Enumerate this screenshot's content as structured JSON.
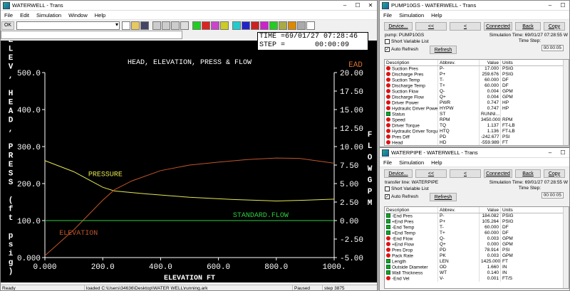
{
  "main": {
    "title": "WATERWELL - Trans",
    "menu": [
      "File",
      "Edit",
      "Simulation",
      "Window",
      "Help"
    ],
    "ok_label": "OK",
    "time_label": "TIME =",
    "time_value": "69/01/27 07:28:46",
    "step_label": "STEP =",
    "step_value": "00:00:09",
    "status": {
      "left": "Ready",
      "file": "loaded C:\\Users\\34636\\Desktop\\WATER WELL\\running.ark",
      "state": "Paused",
      "step": "step 3875"
    }
  },
  "chart_data": {
    "type": "line",
    "title": "HEAD, ELEVATION, PRESS & FLOW",
    "xlabel": "ELEVATION FT",
    "ylabel_left": "ELEV, HEAD, PRESS (ft psig)",
    "ylabel_right": "FLOW GPM",
    "ylabel_right_top": "EAD",
    "xlim": [
      0,
      1000
    ],
    "ylim_left": [
      0,
      500
    ],
    "ylim_right": [
      -5,
      20
    ],
    "x_ticks": [
      "0.000",
      "200.0",
      "400.0",
      "600.0",
      "800.0",
      "1000."
    ],
    "y_ticks_left": [
      "0.000",
      "100.0",
      "200.0",
      "300.0",
      "400.0",
      "500.0"
    ],
    "y_ticks_right": [
      "-5.00",
      "-2.50",
      "0.00",
      "2.50",
      "5.00",
      "7.50",
      "10.00",
      "12.50",
      "15.00",
      "17.50",
      "20.00"
    ],
    "series": [
      {
        "name": "PRESSURE",
        "color": "#e6e650",
        "axis": "left",
        "x": [
          0,
          100,
          200,
          240,
          350,
          500,
          650,
          800,
          900,
          1000
        ],
        "y": [
          262,
          232,
          190,
          180,
          172,
          163,
          157,
          153,
          155,
          158
        ]
      },
      {
        "name": "ELEVATION",
        "color": "#c0552a",
        "axis": "left",
        "x": [
          0,
          100,
          200,
          240,
          300,
          400,
          500,
          600,
          700,
          800,
          880,
          1000
        ],
        "y": [
          5,
          75,
          155,
          183,
          207,
          235,
          250,
          258,
          265,
          269,
          268,
          255
        ]
      },
      {
        "name": "STANDARD.FLOW",
        "color": "#2ecc40",
        "axis": "right",
        "x": [
          0,
          1000
        ],
        "y": [
          0,
          0
        ]
      }
    ],
    "labels": [
      {
        "text": "PRESSURE",
        "color": "#e6e650"
      },
      {
        "text": "ELEVATION",
        "color": "#c0552a"
      },
      {
        "text": "STANDARD.FLOW",
        "color": "#2ecc40"
      }
    ]
  },
  "pump": {
    "title": "PUMP10GS - WATERWELL - Trans",
    "menu": [
      "File",
      "Simulation",
      "Help"
    ],
    "buttons": [
      "Device...",
      "<<",
      "<",
      "Connected",
      "Back",
      "Copy"
    ],
    "name": "pump: PUMP10GS",
    "sim_time_label": "Simulation Time:",
    "sim_time": "69/01/27 07:28:55 W",
    "time_step_label": "Time Step:",
    "time_step": "00:00:05",
    "short_var": "Short Variable List",
    "auto_refresh": "Auto Refresh",
    "refresh": "Refresh",
    "headers": [
      "Description",
      "Abbrev.",
      "Value",
      "Units"
    ],
    "rows": [
      {
        "d": "Suction Pres",
        "a": "P-",
        "v": "17.000",
        "u": "PSIG",
        "i": "dot"
      },
      {
        "d": "Discharge Pres",
        "a": "P+",
        "v": "259.676",
        "u": "PSIG",
        "i": "dot"
      },
      {
        "d": "Suction Temp",
        "a": "T-",
        "v": "60.000",
        "u": "DF",
        "i": "dot"
      },
      {
        "d": "Discharge Temp",
        "a": "T+",
        "v": "60.000",
        "u": "DF",
        "i": "dot"
      },
      {
        "d": "Suction Flow",
        "a": "Q-",
        "v": "0.004",
        "u": "GPM",
        "i": "dot"
      },
      {
        "d": "Discharge Flow",
        "a": "Q+",
        "v": "0.004",
        "u": "GPM",
        "i": "dot"
      },
      {
        "d": "Driver Power",
        "a": "PWR",
        "v": "0.747",
        "u": "HP",
        "i": "dot"
      },
      {
        "d": "Hydraulic Driver Power",
        "a": "HYPW",
        "v": "0.747",
        "u": "HP",
        "i": "dot"
      },
      {
        "d": "Status",
        "a": "ST",
        "v": "RUNNI...",
        "u": "",
        "i": "sq"
      },
      {
        "d": "Speed",
        "a": "RPM",
        "v": "3450.000",
        "u": "RPM",
        "i": "dot"
      },
      {
        "d": "Driver Torque",
        "a": "TQ",
        "v": "1.137",
        "u": "FT-LB",
        "i": "dot"
      },
      {
        "d": "Hydraulic Driver Torque",
        "a": "HTQ",
        "v": "1.136",
        "u": "FT-LB",
        "i": "dot"
      },
      {
        "d": "Pres Diff",
        "a": "PD",
        "v": "-242.677",
        "u": "PSI",
        "i": "dot"
      },
      {
        "d": "Head",
        "a": "HD",
        "v": "-559.989",
        "u": "FT",
        "i": "dot"
      }
    ]
  },
  "pipe": {
    "title": "WATERPIPE - WATERWELL - Trans",
    "menu": [
      "File",
      "Simulation",
      "Help"
    ],
    "buttons": [
      "Device...",
      "<<",
      "<",
      "Connected",
      "Back",
      "Copy"
    ],
    "name": "transfer line: WATERPIPE",
    "sim_time_label": "Simulation Time:",
    "sim_time": "69/01/27 07:28:55 W",
    "time_step_label": "Time Step:",
    "time_step": "00:00:05",
    "short_var": "Short Variable List",
    "auto_refresh": "Auto Refresh",
    "refresh": "Refresh",
    "headers": [
      "Description",
      "Abbrev.",
      "Value",
      "Units"
    ],
    "rows": [
      {
        "d": "-End Pres",
        "a": "P-",
        "v": "184.082",
        "u": "PSIG",
        "i": "sq"
      },
      {
        "d": "+End Pres",
        "a": "P+",
        "v": "105.264",
        "u": "PSIG",
        "i": "sq"
      },
      {
        "d": "-End Temp",
        "a": "T-",
        "v": "60.000",
        "u": "DF",
        "i": "sq"
      },
      {
        "d": "+End Temp",
        "a": "T+",
        "v": "60.000",
        "u": "DF",
        "i": "sq"
      },
      {
        "d": "-End Flow",
        "a": "Q-",
        "v": "0.003",
        "u": "GPM",
        "i": "dot"
      },
      {
        "d": "+End Flow",
        "a": "Q+",
        "v": "0.000",
        "u": "GPM",
        "i": "dot"
      },
      {
        "d": "Pres Drop",
        "a": "PD",
        "v": "78.914",
        "u": "PSI",
        "i": "dot"
      },
      {
        "d": "Pack Rate",
        "a": "PK",
        "v": "0.003",
        "u": "GPM",
        "i": "dot"
      },
      {
        "d": "Length",
        "a": "LEN",
        "v": "1425.000",
        "u": "FT",
        "i": "sq"
      },
      {
        "d": "Outside Diameter",
        "a": "OD",
        "v": "1.660",
        "u": "IN",
        "i": "sq"
      },
      {
        "d": "Wall Thickness",
        "a": "WT",
        "v": "0.140",
        "u": "IN",
        "i": "sq"
      },
      {
        "d": "-End Vel",
        "a": "V-",
        "v": "0.001",
        "u": "FT/S",
        "i": "dot"
      }
    ]
  }
}
